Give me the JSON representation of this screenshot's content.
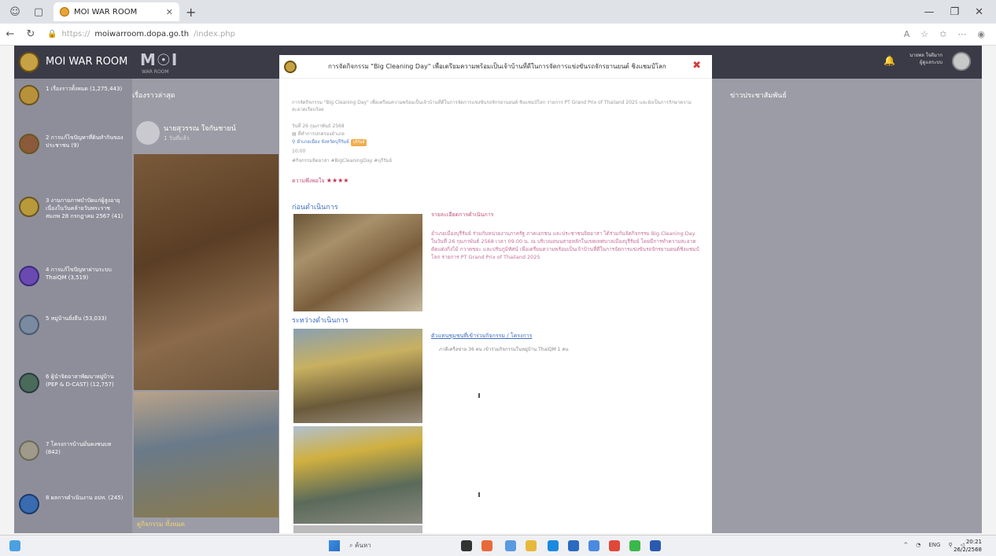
{
  "browser": {
    "tab_title": "MOI WAR ROOM",
    "url_protocol": "https://",
    "url_host": "moiwarroom.dopa.go.th",
    "url_path": "/index.php"
  },
  "site": {
    "name": "MOI WAR ROOM",
    "logo_text": "M☉I",
    "logo_sub": "WAR ROOM",
    "header_user_line1": "นายพล ใจดีมาก",
    "header_user_line2": "ผู้ดูแลระบบ",
    "feed_title": "เรื่องราวล่าสุด",
    "pr_title": "ข่าวประชาสัมพันธ์",
    "post_author": "นายสุวรรณ ใจกันชายน์",
    "post_time": "1 วันที่แล้ว",
    "feed_more": "ดูกิจกรรม ทั้งหมด"
  },
  "sidebar": {
    "items": [
      {
        "label": "1 เรื่องราวทั้งหมด (1,275,443)"
      },
      {
        "label": "2 การแก้ไขปัญหาที่ดินทำกินของประชาชน (9)"
      },
      {
        "label": "3 งานกายภาพบำบัดแก่ผู้สูงอายุ เนื่องในวันคล้ายวันพระราชสมภพ 28 กรกฎาคม 2567 (41)"
      },
      {
        "label": "4 การแก้ไขปัญหาผ่านระบบ ThaiQM (3,519)"
      },
      {
        "label": "5 หมู่บ้านยั่งยืน (53,033)"
      },
      {
        "label": "6 ผู้นำจิตอาสาพัฒนาหมู่บ้าน (PEP & D-CAST) (12,757)"
      },
      {
        "label": "7 โครงการบ้านมั่นคงชนบท (842)"
      },
      {
        "label": "8 ผลการดำเนินงาน อปท. (245)"
      }
    ]
  },
  "modal": {
    "title": "การจัดกิจกรรม \"Big Cleaning Day\" เพื่อเตรียมความพร้อมเป็นเจ้าบ้านที่ดีในการจัดการแข่งขันรถจักรยานยนต์ ชิงแชมป์โลก",
    "intro": "การจัดกิจกรรม \"Big Cleaning Day\" เพื่อเตรียมความพร้อมเป็นเจ้าบ้านที่ดีในการจัดการแข่งขันรถจักรยานยนต์ ชิงแชมป์โลก รายการ PT Grand Prix of Thailand 2025 และยังเป็นการรักษาความสะอาดเรียบร้อย",
    "meta_date": "วันที่ 26 กุมภาพันธ์ 2568",
    "meta_org": "ที่ทำการปกครองอำเภอ",
    "location": "อำเภอเมือง จังหวัดบุรีรัมย์",
    "location_tag": "บุรีรัมย์",
    "meta_time": "10:00",
    "tags": "#กิจกรรมจิตอาสา #BigCleaningDay #บุรีรัมย์",
    "rating_label": "ความพึงพอใจ",
    "rating_stars": "★★★★",
    "before_head": "ก่อนดำเนินการ",
    "during_head": "ระหว่างดำเนินการ",
    "detail_head": "รายละเอียดการดำเนินการ",
    "detail_body": "อำเภอเมืองบุรีรัมย์ ร่วมกับหน่วยงานภาครัฐ ภาคเอกชน และประชาชนจิตอาสา ได้ร่วมกันจัดกิจกรรม Big Cleaning Day ในวันที่ 26 กุมภาพันธ์ 2568 เวลา 09.00 น. ณ บริเวณถนนสายหลักในเขตเทศบาลเมืองบุรีรัมย์ โดยมีการทำความสะอาด ตัดแต่งกิ่งไม้ กวาดขยะ และปรับภูมิทัศน์ เพื่อเตรียมความพร้อมเป็นเจ้าบ้านที่ดีในการจัดการแข่งขันรถจักรยานยนต์ชิงแชมป์โลก รายการ PT Grand Prix of Thailand 2025",
    "project_link": "ตัวแทนชุมชนที่เข้าร่วมกิจกรรม / โครงการ",
    "project_sub": "ภาคีเครือข่าย 36 คน เข้าร่วมกิจกรรมในหมู่บ้าน ThaiQM 1 คน"
  },
  "taskbar": {
    "search": "ค้นหา",
    "lang": "ENG",
    "time": "20:21",
    "date": "26/2/2568"
  },
  "colors": {
    "header": "#3a3b47",
    "overlay": "#9c9ca6",
    "link_blue": "#3c6cc0",
    "accent_pink": "#c04d7a",
    "close_red": "#d23b3b"
  }
}
